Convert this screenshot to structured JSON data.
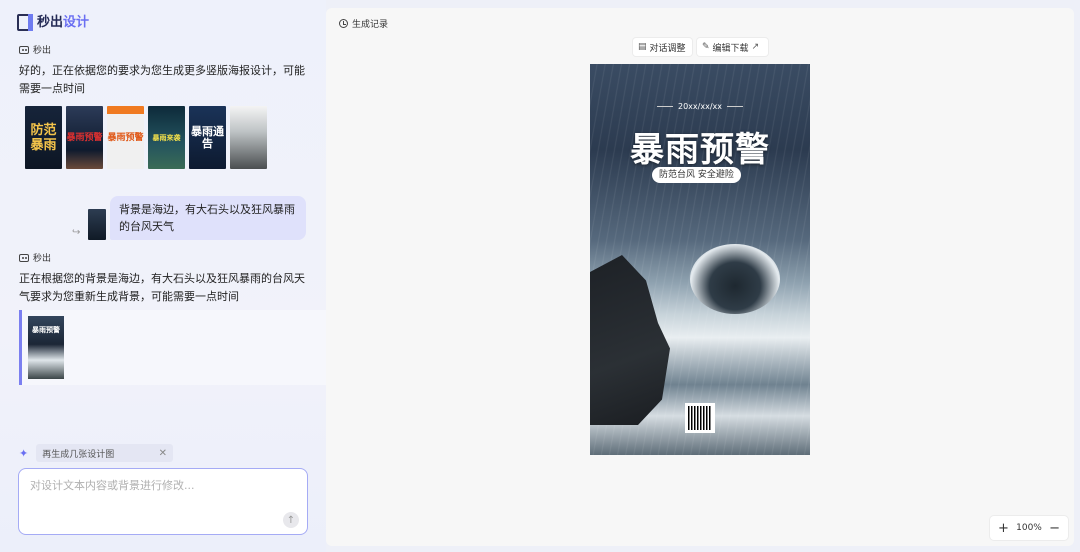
{
  "app": {
    "logo_main": "秒出",
    "logo_accent": "设计"
  },
  "chat": {
    "bot_name": "秒出",
    "msg1": "好的，正在依据您的要求为您生成更多竖版海报设计，可能需要一点时间",
    "thumbs": [
      {
        "label": "防范暴雨",
        "icon": "poster-thumb"
      },
      {
        "label": "暴雨预警",
        "icon": "poster-thumb"
      },
      {
        "label": "暴雨预警",
        "icon": "poster-thumb"
      },
      {
        "label": "暴雨来袭",
        "icon": "poster-thumb"
      },
      {
        "label": "暴雨通告",
        "icon": "poster-thumb"
      },
      {
        "label": "",
        "icon": "poster-thumb"
      }
    ],
    "user_msg": "背景是海边，有大石头以及狂风暴雨的台风天气",
    "msg2": "正在根据您的背景是海边，有大石头以及狂风暴雨的台风天气要求为您重新生成背景，可能需要一点时间",
    "result_label": "暴雨预警"
  },
  "composer": {
    "chip_label": "再生成几张设计图",
    "placeholder": "对设计文本内容或背景进行修改..."
  },
  "canvas": {
    "history_label": "生成记录",
    "btn_chat_adjust": "对话调整",
    "btn_edit_download": "编辑下载",
    "poster": {
      "date": "20xx/xx/xx",
      "title": "暴雨预警",
      "subtitle": "防范台风 安全避险"
    },
    "zoom_level": "100%"
  },
  "colors": {
    "accent": "#6a6ff2",
    "bubble": "#dfe1fb"
  }
}
